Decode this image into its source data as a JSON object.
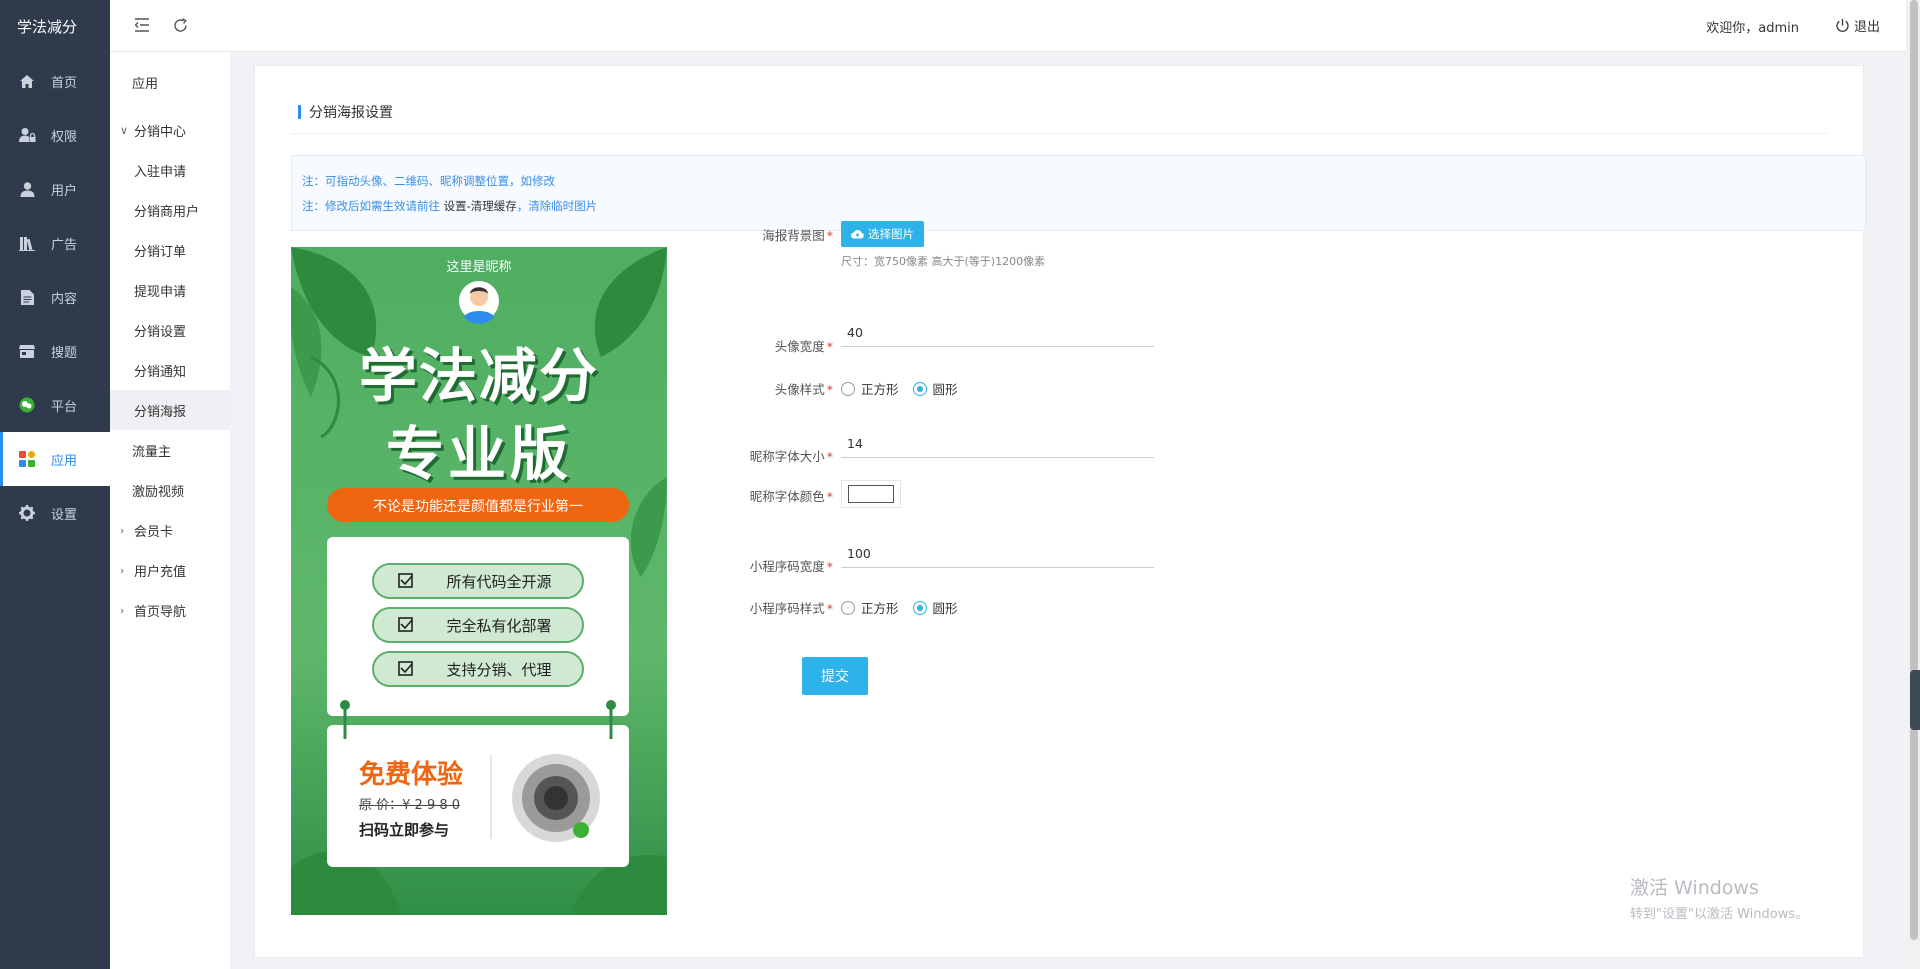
{
  "brand": "学法减分",
  "sidebar": {
    "items": [
      {
        "label": "首页",
        "icon": "home-icon"
      },
      {
        "label": "权限",
        "icon": "user-lock-icon"
      },
      {
        "label": "用户",
        "icon": "user-icon"
      },
      {
        "label": "广告",
        "icon": "books-icon"
      },
      {
        "label": "内容",
        "icon": "document-icon"
      },
      {
        "label": "搜题",
        "icon": "store-icon"
      },
      {
        "label": "平台",
        "icon": "wechat-icon"
      },
      {
        "label": "应用",
        "icon": "apps-icon"
      },
      {
        "label": "设置",
        "icon": "gear-icon"
      }
    ],
    "active_index": 7
  },
  "subnav": {
    "top": "应用",
    "group_open": "分销中心",
    "children": [
      "入驻申请",
      "分销商用户",
      "分销订单",
      "提现申请",
      "分销设置",
      "分销通知",
      "分销海报"
    ],
    "selected": "分销海报",
    "after": [
      "流量主",
      "激励视频"
    ],
    "groups_closed": [
      "会员卡",
      "用户充值",
      "首页导航"
    ]
  },
  "header": {
    "welcome": "欢迎你，admin",
    "logout": "退出"
  },
  "page": {
    "title": "分销海报设置",
    "notice_1": "注：可指动头像、二维码、昵称调整位置，如修改",
    "notice_2_pre": "注：修改后如需生效请前往 ",
    "notice_2_hl": "设置-清理缓存",
    "notice_2_post": "，清除临时图片"
  },
  "poster": {
    "nickname": "这里是昵称",
    "headline_1": "学法减分",
    "headline_2": "专业版",
    "slogan": "不论是功能还是颜值都是行业第一",
    "features": [
      "所有代码全开源",
      "完全私有化部署",
      "支持分销、代理"
    ],
    "free_trial": "免费体验",
    "price": "原  价：¥ 2 9 8 0",
    "scan": "扫码立即参与"
  },
  "form": {
    "bg_label": "海报背景图",
    "bg_button": "选择图片",
    "bg_hint": "尺寸：宽750像素 高大于(等于)1200像素",
    "avatar_width_label": "头像宽度",
    "avatar_width_value": "40",
    "avatar_style_label": "头像样式",
    "nick_size_label": "昵称字体大小",
    "nick_size_value": "14",
    "nick_color_label": "昵称字体颜色",
    "nick_color_value": "#ffffff",
    "qr_width_label": "小程序码宽度",
    "qr_width_value": "100",
    "qr_style_label": "小程序码样式",
    "opt_square": "正方形",
    "opt_circle": "圆形",
    "avatar_style_selected": "圆形",
    "qr_style_selected": "圆形",
    "submit": "提交"
  },
  "watermark": {
    "line1": "激活 Windows",
    "line2": "转到\"设置\"以激活 Windows。"
  },
  "colors": {
    "sidebar_bg": "#2f3a4c",
    "accent": "#2d8cf0",
    "button": "#2db2ea",
    "poster_green": "#4caf60",
    "poster_orange": "#f0650f"
  }
}
